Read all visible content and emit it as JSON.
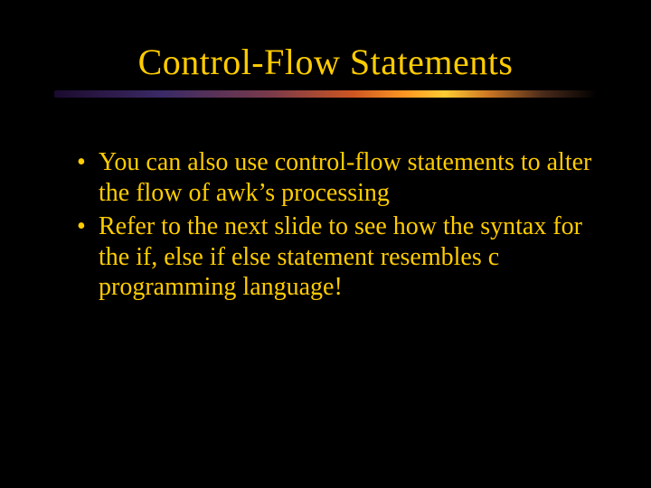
{
  "slide": {
    "title": "Control-Flow Statements",
    "bullets": [
      "You can also use control-flow statements to alter the flow of awk’s processing",
      "Refer to the next slide to see how the syntax for the if, else if else statement resembles c programming language!"
    ]
  }
}
